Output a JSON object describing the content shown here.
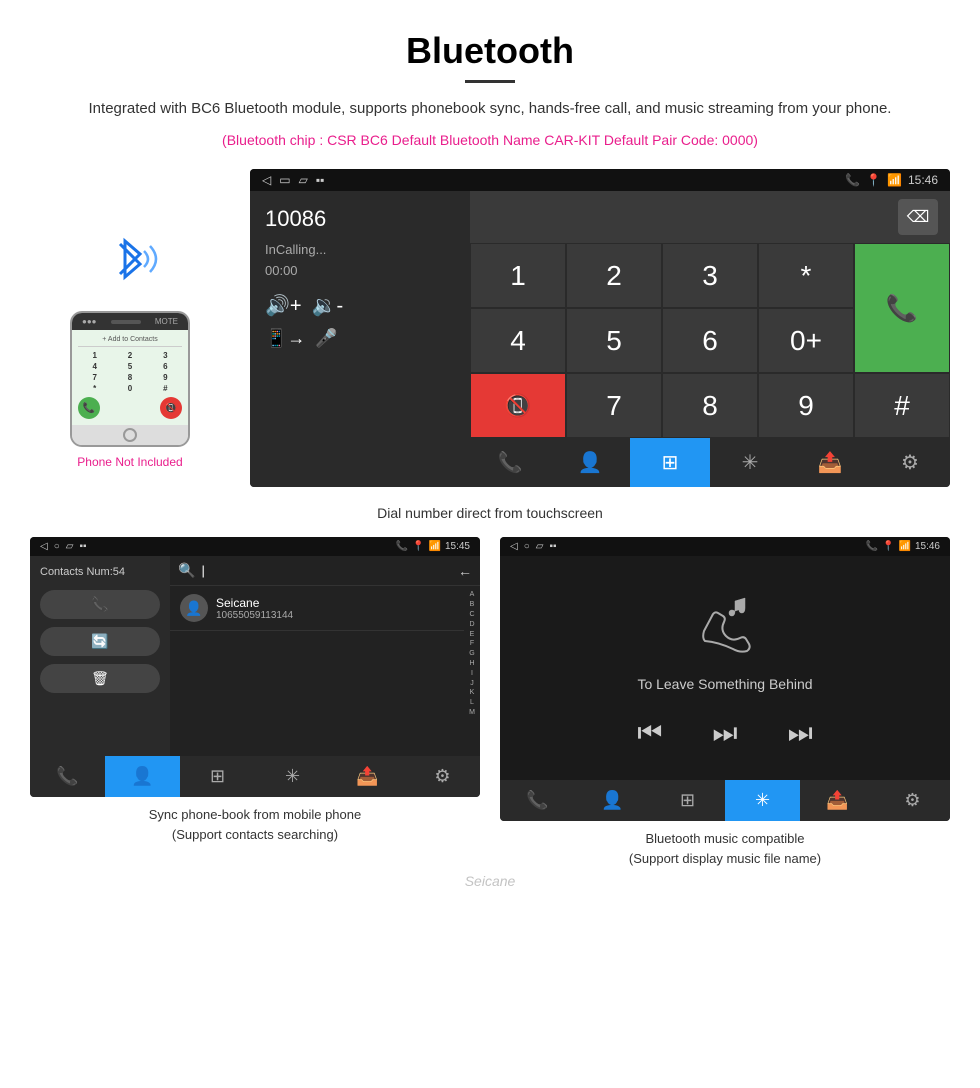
{
  "header": {
    "title": "Bluetooth",
    "description": "Integrated with BC6 Bluetooth module, supports phonebook sync, hands-free call, and music streaming from your phone.",
    "specs": "(Bluetooth chip : CSR BC6    Default Bluetooth Name CAR-KIT    Default Pair Code: 0000)"
  },
  "phone_mockup": {
    "not_included_label": "Phone Not Included",
    "keys": [
      "1",
      "2",
      "3",
      "4",
      "5",
      "6",
      "7",
      "8",
      "9",
      "*",
      "0",
      "#"
    ]
  },
  "dial_screen": {
    "status_bar": {
      "time": "15:46",
      "icons_left": [
        "◁",
        "▭",
        "▱",
        "▪▪"
      ]
    },
    "number": "10086",
    "calling_label": "InCalling...",
    "timer": "00:00",
    "keypad": [
      "1",
      "2",
      "3",
      "*",
      "4",
      "5",
      "6",
      "0+",
      "7",
      "8",
      "9",
      "#"
    ],
    "caption": "Dial number direct from touchscreen"
  },
  "contacts_screen": {
    "status_bar": {
      "time": "15:45"
    },
    "contacts_num": "Contacts Num:54",
    "search_placeholder": "",
    "contact": {
      "name": "Seicane",
      "number": "10655059113144"
    },
    "alpha_letters": [
      "A",
      "B",
      "C",
      "D",
      "E",
      "F",
      "G",
      "H",
      "I",
      "J",
      "K",
      "L",
      "M"
    ],
    "caption_line1": "Sync phone-book from mobile phone",
    "caption_line2": "(Support contacts searching)"
  },
  "music_screen": {
    "status_bar": {
      "time": "15:46"
    },
    "song_title": "To Leave Something Behind",
    "caption_line1": "Bluetooth music compatible",
    "caption_line2": "(Support display music file name)"
  },
  "watermark": "Seicane"
}
